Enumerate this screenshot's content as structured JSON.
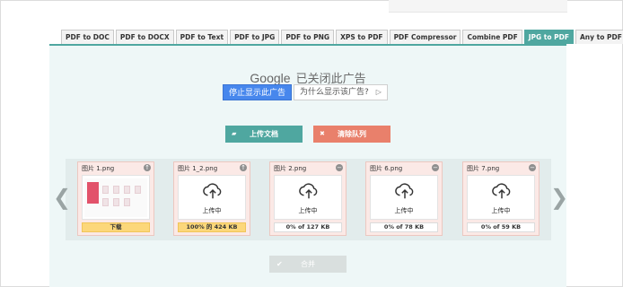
{
  "tabs": [
    {
      "label": "PDF to DOC",
      "active": false
    },
    {
      "label": "PDF to DOCX",
      "active": false
    },
    {
      "label": "PDF to Text",
      "active": false
    },
    {
      "label": "PDF to JPG",
      "active": false
    },
    {
      "label": "PDF to PNG",
      "active": false
    },
    {
      "label": "XPS to PDF",
      "active": false
    },
    {
      "label": "PDF Compressor",
      "active": false
    },
    {
      "label": "Combine PDF",
      "active": false
    },
    {
      "label": "JPG to PDF",
      "active": true
    },
    {
      "label": "Any to PDF",
      "active": false
    }
  ],
  "ad": {
    "brand": "Google",
    "closed_text": "已关闭此广告",
    "stop_label": "停止显示此广告",
    "why_label": "为什么显示该广告?"
  },
  "actions": {
    "upload_label": "上传文档",
    "clear_label": "清除队列"
  },
  "cards": [
    {
      "name": "图片 1.png",
      "thumb_label": "",
      "status": "下载",
      "status_done": true,
      "control": "up"
    },
    {
      "name": "图片 1_2.png",
      "thumb_label": "上传中",
      "status": "100% 的 424 KB",
      "status_done": true,
      "control": "up"
    },
    {
      "name": "图片 2.png",
      "thumb_label": "上传中",
      "status": "0% of 127 KB",
      "status_done": false,
      "control": "remove"
    },
    {
      "name": "图片 6.png",
      "thumb_label": "上传中",
      "status": "0% of 78 KB",
      "status_done": false,
      "control": "remove"
    },
    {
      "name": "图片 7.png",
      "thumb_label": "上传中",
      "status": "0% of 59 KB",
      "status_done": false,
      "control": "remove"
    }
  ],
  "nav": {
    "prev": "❮",
    "next": "❯"
  },
  "merge_label": "合并",
  "colors": {
    "accent": "#4fa7a0",
    "danger": "#e9806b",
    "status_done": "#fcd77a",
    "ad_blue": "#4787ed"
  }
}
